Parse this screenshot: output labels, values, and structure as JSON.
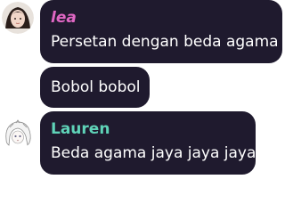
{
  "messages": [
    {
      "username": "lea",
      "username_color": "#e067c4",
      "avatar": "dark-haired-girl-avatar",
      "text": "Persetan dengan beda agama"
    },
    {
      "text": "Bobol bobol"
    },
    {
      "username": "Lauren",
      "username_color": "#5fd3b8",
      "avatar": "white-haired-anime-avatar",
      "text": "Beda agama jaya jaya jaya"
    }
  ],
  "colors": {
    "bubble_bg": "#1f1a2e",
    "text": "#ffffff",
    "page_bg": "#ffffff"
  }
}
